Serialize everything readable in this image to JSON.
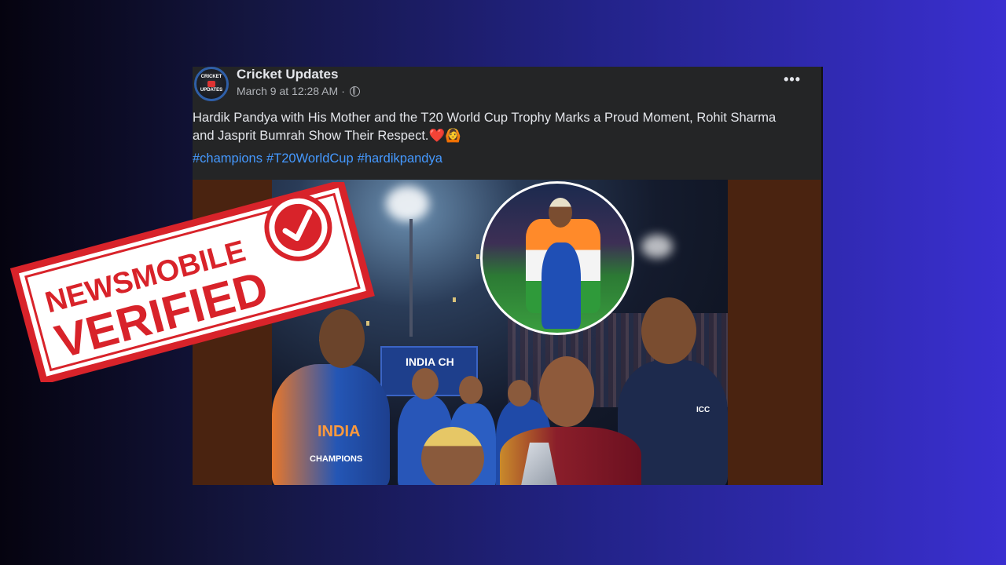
{
  "post": {
    "page_name": "Cricket Updates",
    "avatar_text_line1": "CRICKET",
    "avatar_text_line2": "UPDATES",
    "timestamp": "March 9 at 12:28 AM",
    "separator": "·",
    "more_label": "•••",
    "caption": "Hardik Pandya with His Mother and the T20 World Cup Trophy Marks a Proud Moment, Rohit Sharma and Jasprit Bumrah Show Their Respect.❤️🙆",
    "hashtags": [
      "#champions",
      "#T20WorldCup",
      "#hardikpandya"
    ],
    "photo_screen_text": "INDIA CH",
    "jersey_text": "INDIA",
    "jersey_text2": "CHAMPIONS",
    "icc_text": "ICC"
  },
  "stamp": {
    "line1": "NEWSMOBILE",
    "line2": "VERIFIED",
    "color": "#d8232a"
  },
  "colors": {
    "post_bg": "#242526",
    "hashtag": "#4599ff",
    "media_bg": "#4a2310"
  },
  "icons": [
    "globe-icon",
    "more-options-icon",
    "check-icon"
  ]
}
